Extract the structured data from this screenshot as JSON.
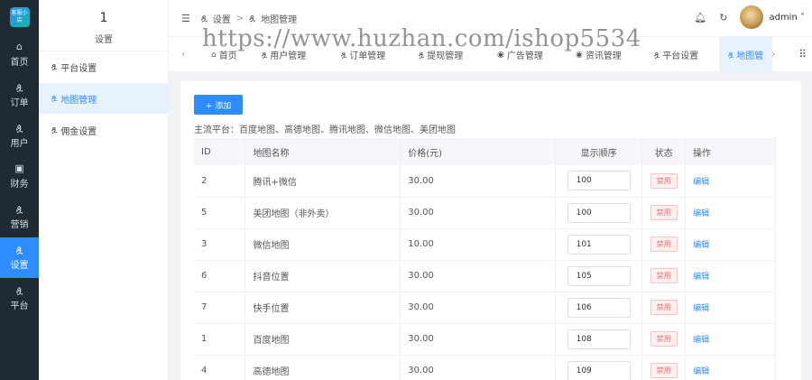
{
  "rail": {
    "logo_text": "客服小店",
    "items": [
      {
        "label": "首页",
        "icon": "home-icon",
        "glyph": "⌂",
        "active": false
      },
      {
        "label": "订单",
        "icon": "user-icon",
        "glyph": "ዿ",
        "active": false
      },
      {
        "label": "用户",
        "icon": "user-icon",
        "glyph": "ዿ",
        "active": false
      },
      {
        "label": "财务",
        "icon": "wallet-icon",
        "glyph": "▣",
        "active": false
      },
      {
        "label": "营销",
        "icon": "user-icon",
        "glyph": "ዿ",
        "active": false
      },
      {
        "label": "设置",
        "icon": "user-icon",
        "glyph": "ዿ",
        "active": true
      },
      {
        "label": "平台",
        "icon": "user-icon",
        "glyph": "ዿ",
        "active": false
      }
    ]
  },
  "side": {
    "number": "1",
    "title": "设置",
    "items": [
      {
        "label": "平台设置",
        "active": false
      },
      {
        "label": "地图管理",
        "active": true
      },
      {
        "label": "佣金设置",
        "active": false
      }
    ]
  },
  "header": {
    "breadcrumb": [
      "设置",
      "地图管理"
    ],
    "breadcrumb_sep": ">",
    "username": "admin",
    "watermark": "https://www.huzhan.com/ishop5534"
  },
  "tabs": [
    {
      "label": "首页",
      "active": false
    },
    {
      "label": "用户管理",
      "active": false
    },
    {
      "label": "订单管理",
      "active": false
    },
    {
      "label": "提现管理",
      "active": false
    },
    {
      "label": "广告管理",
      "active": false
    },
    {
      "label": "资讯管理",
      "active": false
    },
    {
      "label": "平台设置",
      "active": false
    },
    {
      "label": "地图管",
      "active": true
    }
  ],
  "main": {
    "add_label": "+ 添加",
    "notice": "主流平台：百度地图、高德地图、腾讯地图、微信地图、美团地图",
    "columns": [
      "ID",
      "地图名称",
      "价格(元)",
      "显示顺序",
      "状态",
      "操作"
    ],
    "rows": [
      {
        "id": "2",
        "name": "腾讯+微信",
        "price": "30.00",
        "order": "100",
        "status": "禁用",
        "op": "编辑"
      },
      {
        "id": "5",
        "name": "美团地图（非外卖）",
        "price": "30.00",
        "order": "100",
        "status": "禁用",
        "op": "编辑"
      },
      {
        "id": "3",
        "name": "微信地图",
        "price": "10.00",
        "order": "101",
        "status": "禁用",
        "op": "编辑"
      },
      {
        "id": "6",
        "name": "抖音位置",
        "price": "30.00",
        "order": "105",
        "status": "禁用",
        "op": "编辑"
      },
      {
        "id": "7",
        "name": "快手位置",
        "price": "30.00",
        "order": "106",
        "status": "禁用",
        "op": "编辑"
      },
      {
        "id": "1",
        "name": "百度地图",
        "price": "30.00",
        "order": "108",
        "status": "禁用",
        "op": "编辑"
      },
      {
        "id": "4",
        "name": "高德地图",
        "price": "30.00",
        "order": "109",
        "status": "禁用",
        "op": "编辑"
      }
    ]
  },
  "colors": {
    "accent": "#2f8cff",
    "rail_bg": "#1f2a33",
    "danger": "#f56c6c"
  }
}
